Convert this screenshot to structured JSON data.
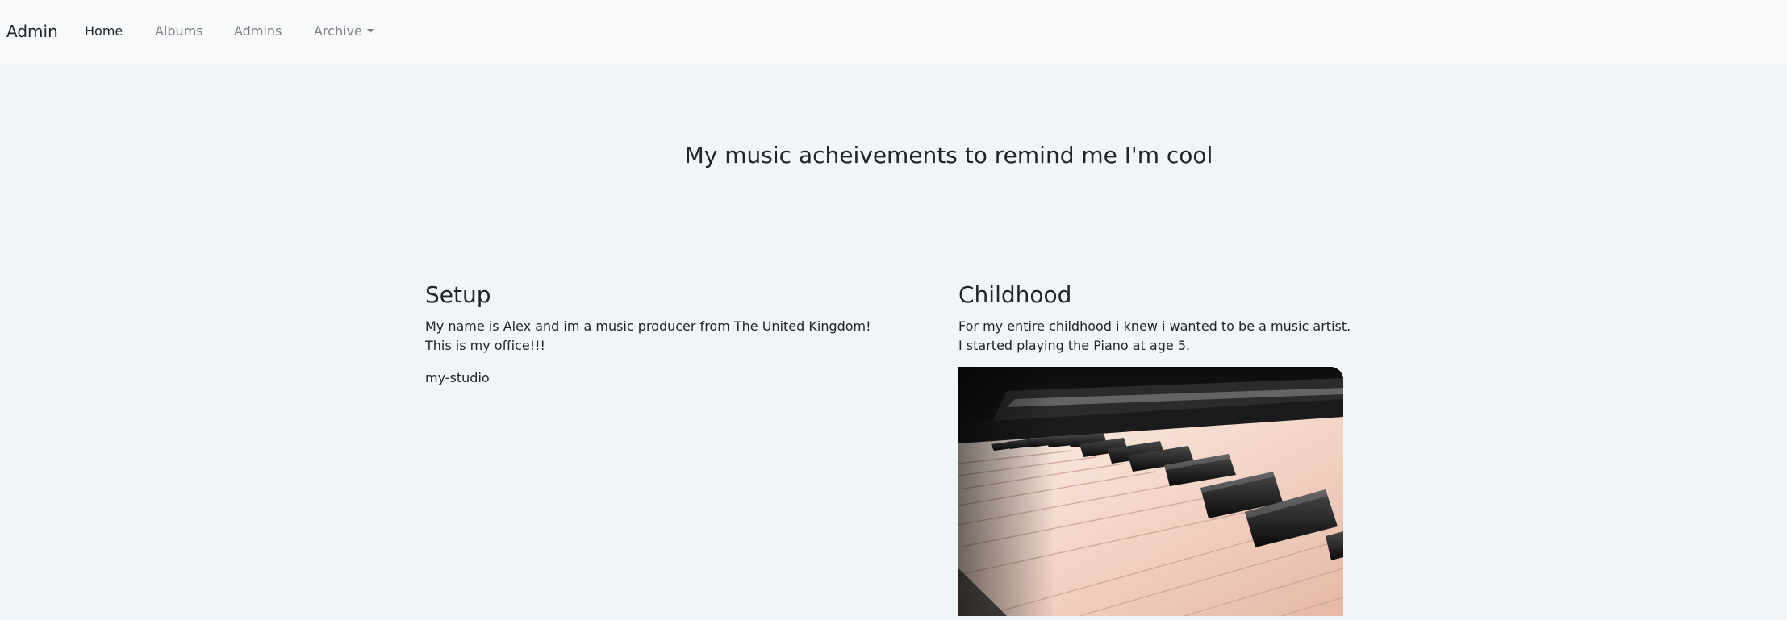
{
  "navbar": {
    "brand": "Admin",
    "links": [
      {
        "label": "Home",
        "active": true
      },
      {
        "label": "Albums",
        "active": false
      },
      {
        "label": "Admins",
        "active": false
      },
      {
        "label": "Archive",
        "active": false,
        "dropdown": true
      }
    ]
  },
  "hero": {
    "title": "My music acheivements to remind me I'm cool"
  },
  "sections": {
    "setup": {
      "heading": "Setup",
      "line1": "My name is Alex and im a music producer from The United Kingdom!",
      "line2": "This is my office!!!",
      "image_alt": "my-studio"
    },
    "childhood": {
      "heading": "Childhood",
      "line1": "For my entire childhood i knew i wanted to be a music artist.",
      "line2": "I started playing the Piano at age 5.",
      "image_subject": "piano-keys-photo"
    }
  },
  "colors": {
    "page_bg": "#f0f5f7",
    "navbar_bg": "#f7f9fa",
    "text": "#212529",
    "muted": "#7c7f83"
  }
}
